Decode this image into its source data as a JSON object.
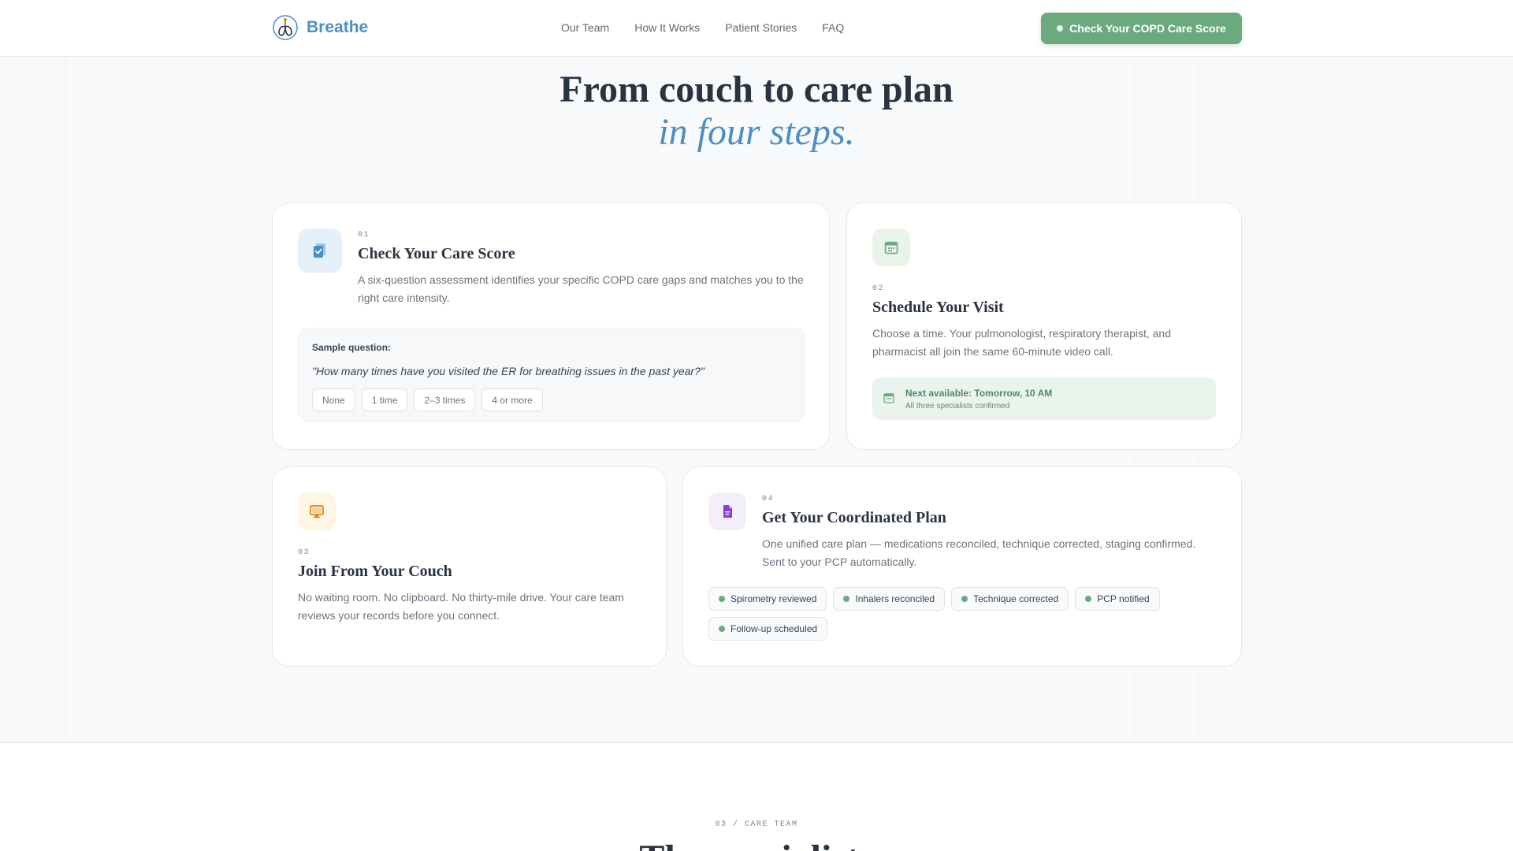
{
  "header": {
    "logo_text": "Breathe",
    "nav": [
      "Our Team",
      "How It Works",
      "Patient Stories",
      "FAQ"
    ],
    "cta_label": "Check Your COPD Care Score"
  },
  "hero": {
    "title": "From couch to care plan",
    "subtitle": "in four steps."
  },
  "steps": [
    {
      "num": "01",
      "title": "Check Your Care Score",
      "desc": "A six-question assessment identifies your specific COPD care gaps and matches you to the right care intensity.",
      "sample_label": "Sample question:",
      "sample_question": "\"How many times have you visited the ER for breathing issues in the past year?\"",
      "options": [
        "None",
        "1 time",
        "2–3 times",
        "4 or more"
      ]
    },
    {
      "num": "02",
      "title": "Schedule Your Visit",
      "desc": "Choose a time. Your pulmonologist, respiratory therapist, and pharmacist all join the same 60-minute video call.",
      "availability": "Next available: Tomorrow, 10 AM",
      "availability_sub": "All three specialists confirmed"
    },
    {
      "num": "03",
      "title": "Join From Your Couch",
      "desc": "No waiting room. No clipboard. No thirty-mile drive. Your care team reviews your records before you connect."
    },
    {
      "num": "04",
      "title": "Get Your Coordinated Plan",
      "desc": "One unified care plan — medications reconciled, technique corrected, staging confirmed. Sent to your PCP automatically.",
      "chips": [
        "Spirometry reviewed",
        "Inhalers reconciled",
        "Technique corrected",
        "PCP notified",
        "Follow-up scheduled"
      ]
    }
  ],
  "next_section": {
    "tag": "03 / CARE TEAM",
    "title": "The specialists"
  },
  "colors": {
    "accent_blue": "#4a8fc4",
    "accent_green": "#6aaa7e",
    "accent_amber": "#d88a1a",
    "accent_purple": "#8a3fd1"
  },
  "icons": {
    "step1": "clipboard-check-icon",
    "step2": "calendar-icon",
    "step3": "monitor-icon",
    "step4": "document-icon"
  }
}
